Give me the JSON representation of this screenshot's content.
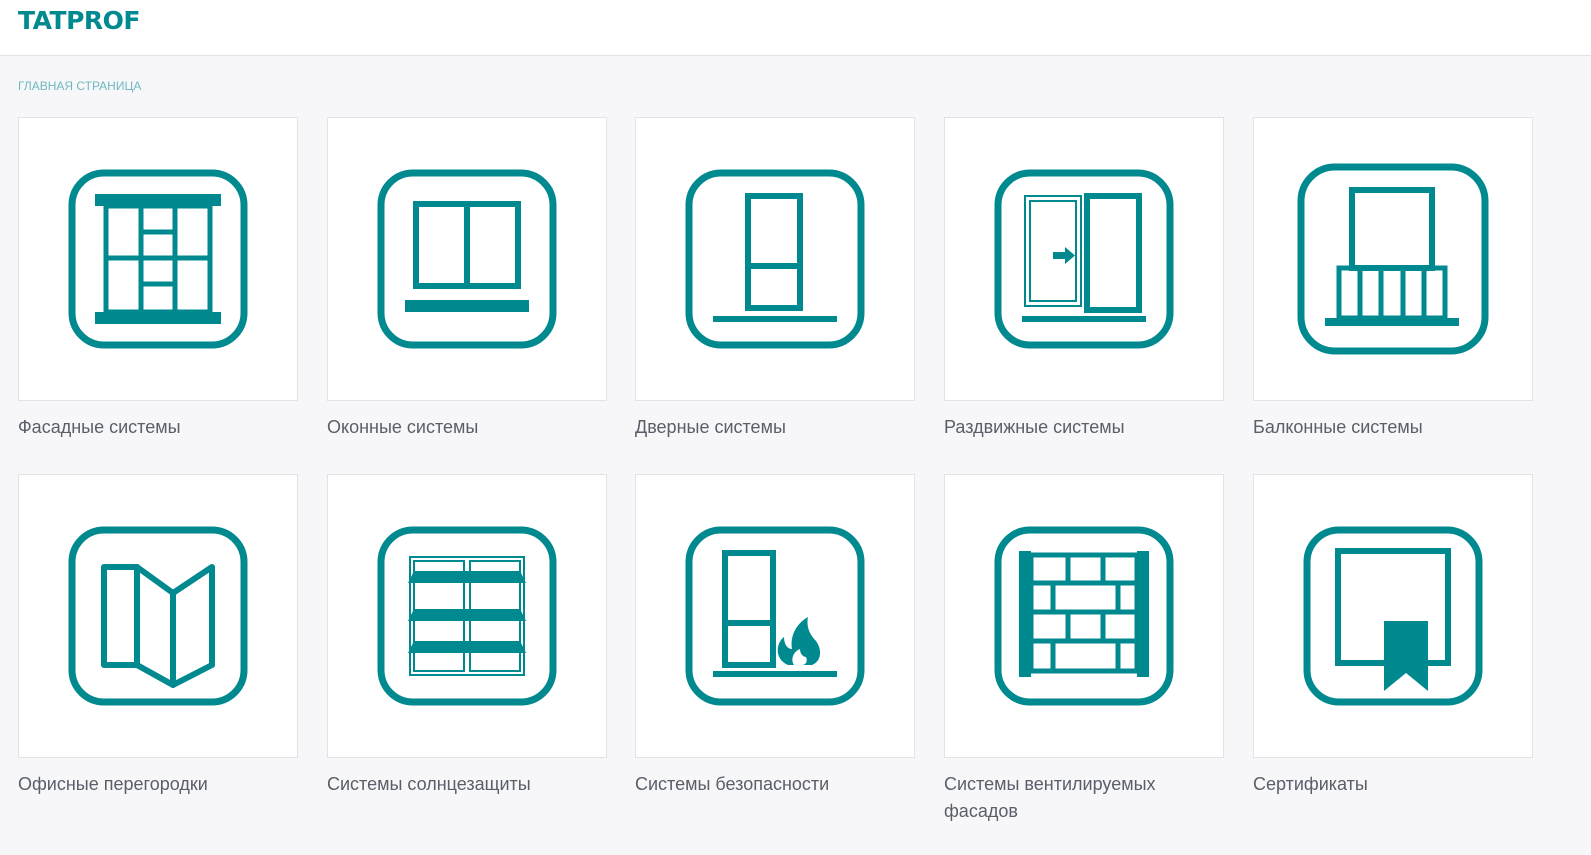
{
  "header": {
    "logo": "TATPROF"
  },
  "breadcrumb": {
    "home": "ГЛАВНАЯ СТРАНИЦА"
  },
  "colors": {
    "brand": "#00898f",
    "background": "#f7f7f9",
    "tile": "#ffffff",
    "label": "#595e68",
    "breadcrumb": "#6fb8c2"
  },
  "categories": [
    {
      "label": "Фасадные системы",
      "icon": "facade-icon"
    },
    {
      "label": "Оконные системы",
      "icon": "window-icon"
    },
    {
      "label": "Дверные системы",
      "icon": "door-icon"
    },
    {
      "label": "Раздвижные системы",
      "icon": "sliding-door-icon"
    },
    {
      "label": "Балконные системы",
      "icon": "balcony-icon"
    },
    {
      "label": "Офисные перегородки",
      "icon": "office-partition-icon"
    },
    {
      "label": "Системы солнцезащиты",
      "icon": "sun-protection-icon"
    },
    {
      "label": "Системы безопасности",
      "icon": "fire-safety-icon"
    },
    {
      "label": "Системы вентилируемых фасадов",
      "icon": "ventilated-facade-icon"
    },
    {
      "label": "Сертификаты",
      "icon": "certificate-icon"
    }
  ]
}
